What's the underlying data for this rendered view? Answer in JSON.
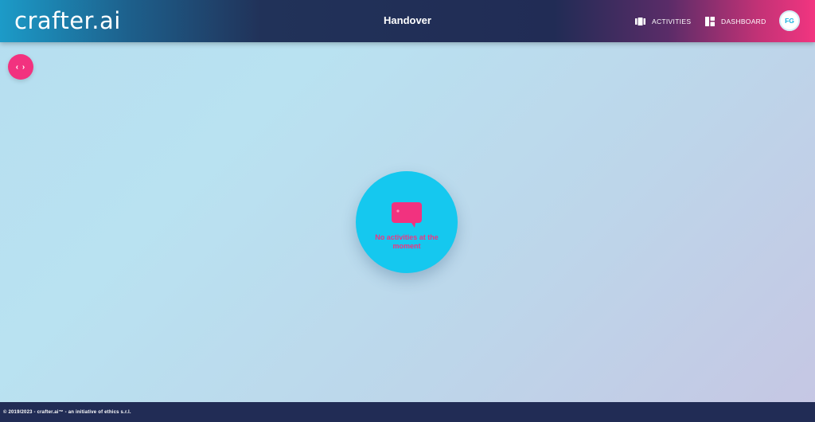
{
  "header": {
    "logo_text": "crafter.ai",
    "title": "Handover",
    "nav": {
      "activities_label": "ACTIVITIES",
      "dashboard_label": "DASHBOARD"
    },
    "avatar_initials": "FG"
  },
  "toolbar": {
    "toggle_glyph": "‹ ›"
  },
  "main": {
    "empty_state_text": "No activities at the moment"
  },
  "footer": {
    "copyright": "© 2019/2023 - crafter.ai™ - an initiative of ethics s.r.l."
  },
  "icons": {
    "toggle": "code-brackets-icon",
    "activities": "activities-icon",
    "dashboard": "dashboard-icon",
    "empty_state": "chat-bubble-icon"
  },
  "colors": {
    "accent_pink": "#f2327f",
    "accent_cyan": "#15c8ef",
    "navy": "#212c55",
    "background": "#b9e2f1"
  }
}
